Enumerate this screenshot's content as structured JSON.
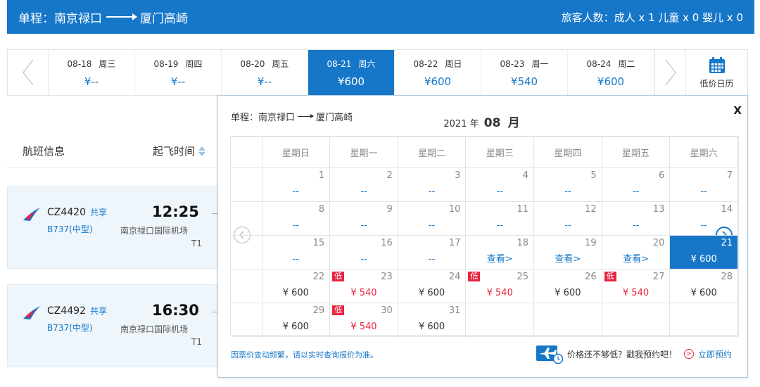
{
  "header": {
    "route_from": "单程：南京禄口",
    "route_to": "厦门高崎",
    "passengers": "旅客人数：成人 x 1 儿童 x 0 婴儿 x 0"
  },
  "date_strip": [
    {
      "date": "08-18",
      "weekday": "周三",
      "price": "¥--"
    },
    {
      "date": "08-19",
      "weekday": "周四",
      "price": "¥--"
    },
    {
      "date": "08-20",
      "weekday": "周五",
      "price": "¥--"
    },
    {
      "date": "08-21",
      "weekday": "周六",
      "price": "¥600"
    },
    {
      "date": "08-22",
      "weekday": "周日",
      "price": "¥600"
    },
    {
      "date": "08-23",
      "weekday": "周一",
      "price": "¥540"
    },
    {
      "date": "08-24",
      "weekday": "周二",
      "price": "¥600"
    }
  ],
  "calendar_entry": {
    "label": "低价日历",
    "icon": "calendar-icon"
  },
  "list": {
    "col_flight": "航班信息",
    "col_depart": "起飞时间"
  },
  "flights": [
    {
      "no": "CZ4420",
      "share": "共享",
      "type": "B737(中型)",
      "time": "12:25",
      "airport": "南京禄口国际机场",
      "terminal": "T1"
    },
    {
      "no": "CZ4492",
      "share": "共享",
      "type": "B737(中型)",
      "time": "16:30",
      "airport": "南京禄口国际机场",
      "terminal": "T1"
    }
  ],
  "popup": {
    "route_from": "单程：南京禄口",
    "route_to": "厦门高崎",
    "year": "2021",
    "year_suffix": "年",
    "month": "08",
    "month_suffix": "月",
    "close": "X",
    "weekdays": [
      "星期日",
      "星期一",
      "星期二",
      "星期三",
      "星期四",
      "星期五",
      "星期六"
    ],
    "low_tag": "低",
    "note": "因票价变动频繁，请以实时查询报价为准。",
    "promo_text": "价格还不够低？戳我预约吧！",
    "promo_link": "立即预约",
    "weeks": [
      [
        {
          "d": "1",
          "p": "--",
          "k": "none"
        },
        {
          "d": "2",
          "p": "--",
          "k": "none"
        },
        {
          "d": "3",
          "p": "--",
          "k": "none"
        },
        {
          "d": "4",
          "p": "--",
          "k": "none"
        },
        {
          "d": "5",
          "p": "--",
          "k": "none"
        },
        {
          "d": "6",
          "p": "--",
          "k": "none"
        },
        {
          "d": "7",
          "p": "--",
          "k": "none"
        }
      ],
      [
        {
          "d": "8",
          "p": "--",
          "k": "none"
        },
        {
          "d": "9",
          "p": "--",
          "k": "none"
        },
        {
          "d": "10",
          "p": "--",
          "k": "none"
        },
        {
          "d": "11",
          "p": "--",
          "k": "none"
        },
        {
          "d": "12",
          "p": "--",
          "k": "none"
        },
        {
          "d": "13",
          "p": "--",
          "k": "none"
        },
        {
          "d": "14",
          "p": "--",
          "k": "none"
        }
      ],
      [
        {
          "d": "15",
          "p": "--",
          "k": "none"
        },
        {
          "d": "16",
          "p": "--",
          "k": "none"
        },
        {
          "d": "17",
          "p": "--",
          "k": "none"
        },
        {
          "d": "18",
          "p": "查看>",
          "k": "view"
        },
        {
          "d": "19",
          "p": "查看>",
          "k": "view"
        },
        {
          "d": "20",
          "p": "查看>",
          "k": "view"
        },
        {
          "d": "21",
          "p": "¥ 600",
          "k": "sel"
        }
      ],
      [
        {
          "d": "22",
          "p": "¥ 600",
          "k": "normal"
        },
        {
          "d": "23",
          "p": "¥ 540",
          "k": "low"
        },
        {
          "d": "24",
          "p": "¥ 600",
          "k": "normal"
        },
        {
          "d": "25",
          "p": "¥ 540",
          "k": "low"
        },
        {
          "d": "26",
          "p": "¥ 600",
          "k": "normal"
        },
        {
          "d": "27",
          "p": "¥ 540",
          "k": "low"
        },
        {
          "d": "28",
          "p": "¥ 600",
          "k": "normal"
        }
      ],
      [
        {
          "d": "29",
          "p": "¥ 600",
          "k": "normal"
        },
        {
          "d": "30",
          "p": "¥ 540",
          "k": "low"
        },
        {
          "d": "31",
          "p": "¥ 600",
          "k": "normal"
        },
        {
          "d": "",
          "p": "",
          "k": "empty"
        },
        {
          "d": "",
          "p": "",
          "k": "empty"
        },
        {
          "d": "",
          "p": "",
          "k": "empty"
        },
        {
          "d": "",
          "p": "",
          "k": "empty"
        }
      ]
    ]
  },
  "colors": {
    "brand": "#1677c9",
    "low": "#e8253f"
  }
}
